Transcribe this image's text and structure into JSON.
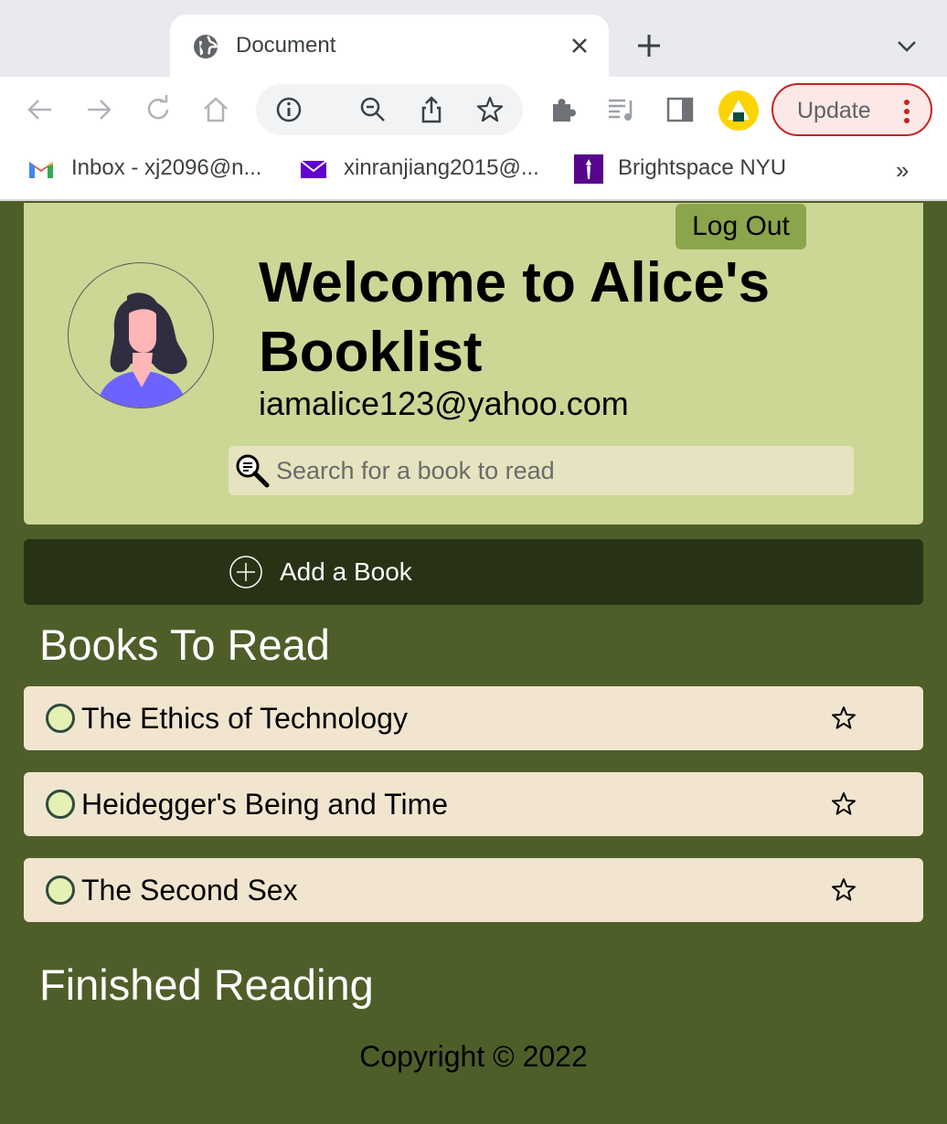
{
  "browser": {
    "tab_title": "Document",
    "update_label": "Update",
    "bookmarks": [
      {
        "label": "Inbox - xj2096@n...",
        "icon": "gmail-icon"
      },
      {
        "label": "xinranjiang2015@...",
        "icon": "yahoo-mail-icon"
      },
      {
        "label": "Brightspace NYU",
        "icon": "nyu-torch-icon"
      }
    ],
    "bookmarks_more": "»",
    "colors": {
      "update_accent": "#c5221f",
      "tab_strip": "#e8eaed"
    }
  },
  "header": {
    "logout_label": "Log Out",
    "title": "Welcome to Alice's Booklist",
    "email": "iamalice123@yahoo.com",
    "search_placeholder": "Search for a book to read"
  },
  "add_book_label": "Add a Book",
  "to_read": {
    "heading": "Books To Read",
    "books": [
      {
        "title": "The Ethics of Technology"
      },
      {
        "title": "Heidegger's Being and Time"
      },
      {
        "title": "The Second Sex"
      }
    ]
  },
  "finished": {
    "heading": "Finished Reading"
  },
  "footer": "Copyright © 2022",
  "colors": {
    "page_bg": "#4e5e29",
    "header_bg": "#ccd796",
    "logout_bg": "#8ba54c",
    "add_book_bg": "#283316",
    "book_row_bg": "#f1e5cf"
  }
}
